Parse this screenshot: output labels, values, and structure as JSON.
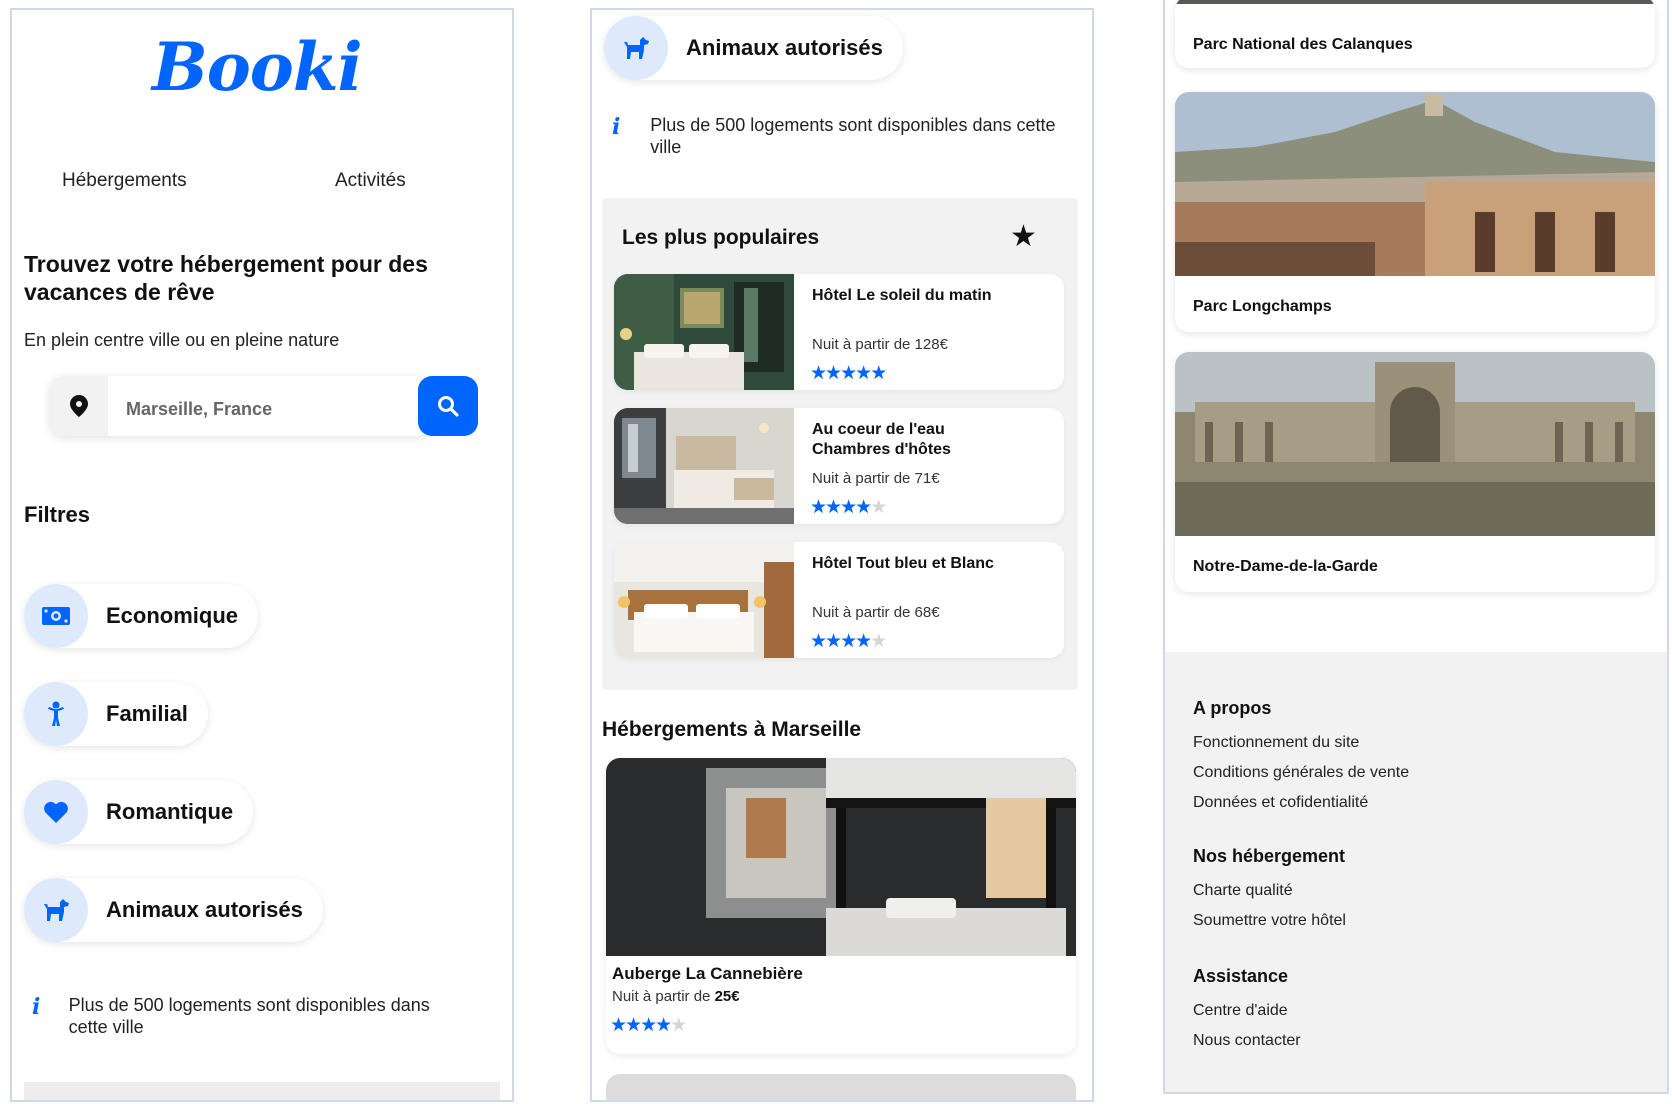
{
  "brand": {
    "logo": "Booki",
    "accent": "#0065fc"
  },
  "nav": {
    "hebergements": "Hébergements",
    "activites": "Activités"
  },
  "hero": {
    "title": "Trouvez votre hébergement pour des vacances de rêve",
    "subtitle": "En plein centre ville ou en pleine nature"
  },
  "search": {
    "value": "Marseille, France"
  },
  "filters": {
    "title": "Filtres",
    "items": [
      {
        "label": "Economique",
        "icon": "money-icon"
      },
      {
        "label": "Familial",
        "icon": "child-icon"
      },
      {
        "label": "Romantique",
        "icon": "heart-icon"
      },
      {
        "label": "Animaux autorisés",
        "icon": "dog-icon"
      }
    ]
  },
  "info": {
    "text": "Plus de 500 logements sont disponibles dans cette ville"
  },
  "popular": {
    "title": "Les plus populaires",
    "items": [
      {
        "name": "Hôtel Le soleil du matin",
        "price": "Nuit à partir de 128€",
        "rating": 5
      },
      {
        "name": "Au coeur de l'eau Chambres d'hôtes",
        "price": "Nuit à partir de 71€",
        "rating": 4
      },
      {
        "name": "Hôtel Tout bleu et Blanc",
        "price": "Nuit à partir de 68€",
        "rating": 4
      }
    ]
  },
  "hebergements": {
    "title": "Hébergements à Marseille",
    "items": [
      {
        "name": "Auberge La Cannebière",
        "price_prefix": "Nuit à partir de",
        "price": "25€",
        "rating": 4
      }
    ]
  },
  "activities": {
    "items": [
      {
        "label": "Parc National des Calanques"
      },
      {
        "label": "Parc Longchamps"
      },
      {
        "label": "Notre-Dame-de-la-Garde"
      }
    ]
  },
  "footer": {
    "sections": [
      {
        "title": "A propos",
        "links": [
          "Fonctionnement du site",
          "Conditions générales de vente",
          "Données et cofidentialité"
        ]
      },
      {
        "title": "Nos hébergement",
        "links": [
          "Charte qualité",
          "Soumettre votre hôtel"
        ]
      },
      {
        "title": "Assistance",
        "links": [
          "Centre d'aide",
          "Nous contacter"
        ]
      }
    ]
  }
}
